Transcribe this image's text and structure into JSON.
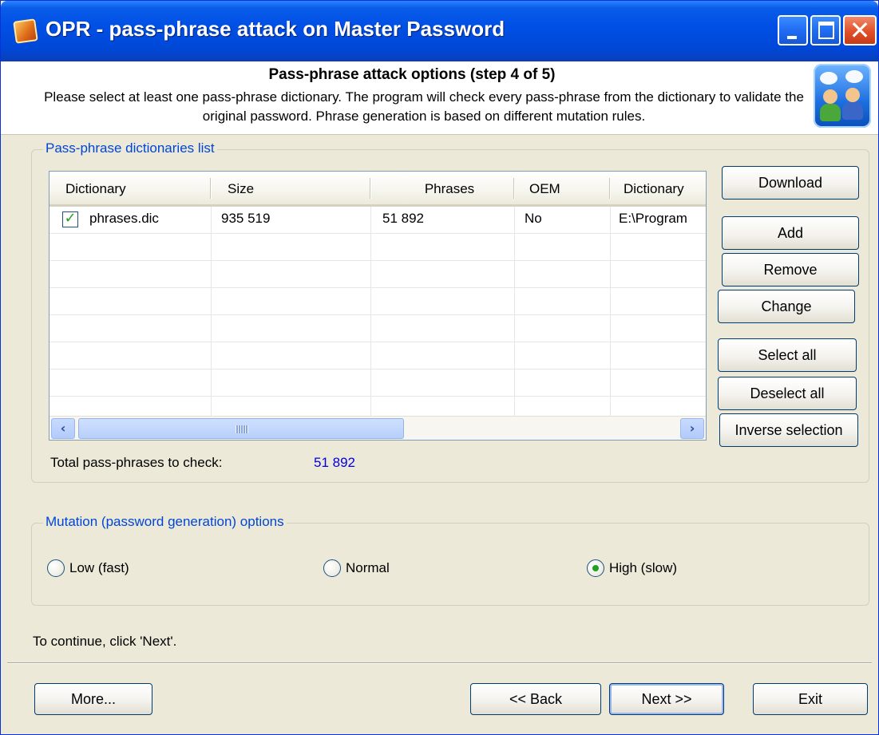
{
  "window": {
    "title": "OPR - pass-phrase attack on Master Password"
  },
  "header": {
    "title": "Pass-phrase attack options (step 4 of 5)",
    "description": "Please select at least one pass-phrase dictionary. The program will check every pass-phrase from the dictionary to validate the original password. Phrase generation is based on different mutation rules."
  },
  "dictionaries": {
    "group_label": "Pass-phrase dictionaries list",
    "columns": [
      "Dictionary",
      "Size",
      "Phrases",
      "OEM",
      "Dictionary"
    ],
    "rows": [
      {
        "checked": true,
        "name": "phrases.dic",
        "size": "935 519",
        "phrases": "51 892",
        "oem": "No",
        "path": "E:\\Program"
      }
    ],
    "total_label": "Total pass-phrases to check:",
    "total_value": "51 892",
    "buttons": {
      "download": "Download",
      "add": "Add",
      "remove": "Remove",
      "change": "Change",
      "select_all": "Select all",
      "deselect_all": "Deselect all",
      "inverse_selection": "Inverse selection"
    }
  },
  "mutation": {
    "group_label": "Mutation (password generation) options",
    "options": [
      {
        "label": "Low (fast)",
        "selected": false
      },
      {
        "label": "Normal",
        "selected": false
      },
      {
        "label": "High (slow)",
        "selected": true
      }
    ]
  },
  "footer": {
    "hint": "To continue, click 'Next'.",
    "more": "More...",
    "back": "<< Back",
    "next": "Next >>",
    "exit": "Exit"
  },
  "colors": {
    "titlebar": "#0050e6",
    "group_label": "#0046d5",
    "total_value": "#0000e0",
    "check_green": "#21a121"
  }
}
